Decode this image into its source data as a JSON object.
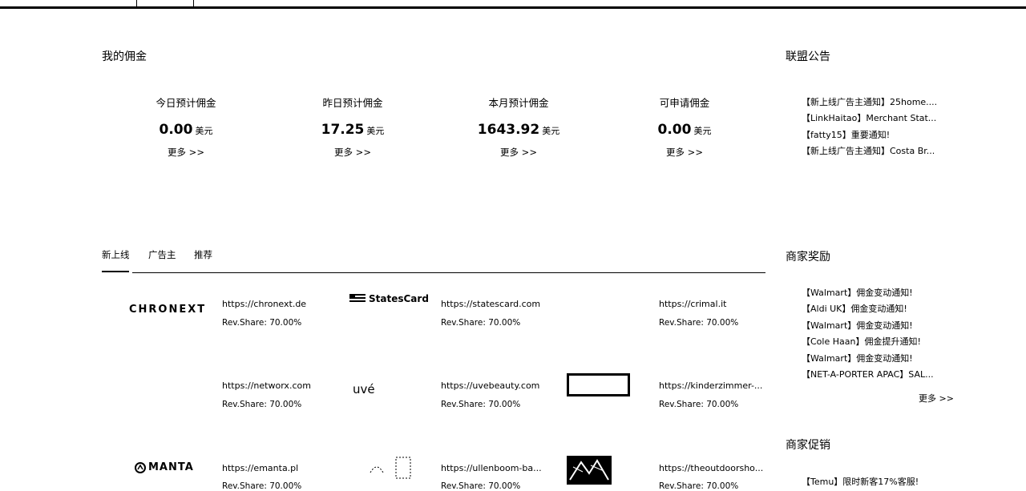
{
  "commission": {
    "title": "我的佣金",
    "stats": [
      {
        "label": "今日预计佣金",
        "value": "0.00",
        "unit": "美元",
        "more": "更多 >>"
      },
      {
        "label": "昨日预计佣金",
        "value": "17.25",
        "unit": "美元",
        "more": "更多 >>"
      },
      {
        "label": "本月预计佣金",
        "value": "1643.92",
        "unit": "美元",
        "more": "更多 >>"
      },
      {
        "label": "可申请佣金",
        "value": "0.00",
        "unit": "美元",
        "more": "更多 >>"
      }
    ]
  },
  "announcements": {
    "title": "联盟公告",
    "items": [
      "【新上线广告主通知】25home....",
      "【LinkHaitao】Merchant Stat...",
      "【fatty15】重要通知!",
      "【新上线广告主通知】Costa Br..."
    ]
  },
  "tabs": [
    "新上线",
    "广告主",
    "推荐"
  ],
  "merchants": [
    {
      "logo": "CHRONEXT",
      "url": "https://chronext.de",
      "rate": "Rev.Share: 70.00%"
    },
    {
      "logo": "StatesCard",
      "url": "https://statescard.com",
      "rate": "Rev.Share: 70.00%"
    },
    {
      "logo": "",
      "url": "https://crimal.it",
      "rate": "Rev.Share: 70.00%"
    },
    {
      "logo": "",
      "url": "https://networx.com",
      "rate": "Rev.Share: 70.00%"
    },
    {
      "logo": "uvé",
      "url": "https://uvebeauty.com",
      "rate": "Rev.Share: 70.00%"
    },
    {
      "logo": "",
      "url": "https://kinderzimmer-...",
      "rate": "Rev.Share: 70.00%"
    },
    {
      "logo": "MANTA",
      "url": "https://emanta.pl",
      "rate": "Rev.Share: 70.00%"
    },
    {
      "logo": "",
      "url": "https://ullenboom-ba...",
      "rate": "Rev.Share: 70.00%"
    },
    {
      "logo": "",
      "url": "https://theoutdoorsho...",
      "rate": "Rev.Share: 70.00%"
    }
  ],
  "rewards": {
    "title": "商家奖励",
    "items": [
      "【Walmart】佣金变动通知!",
      "【Aldi UK】佣金变动通知!",
      "【Walmart】佣金变动通知!",
      "【Cole Haan】佣金提升通知!",
      "【Walmart】佣金变动通知!",
      "【NET-A-PORTER APAC】SAL..."
    ],
    "more": "更多 >>"
  },
  "promotions": {
    "title": "商家促销",
    "items": [
      "【Temu】限时新客17%客服!"
    ]
  }
}
